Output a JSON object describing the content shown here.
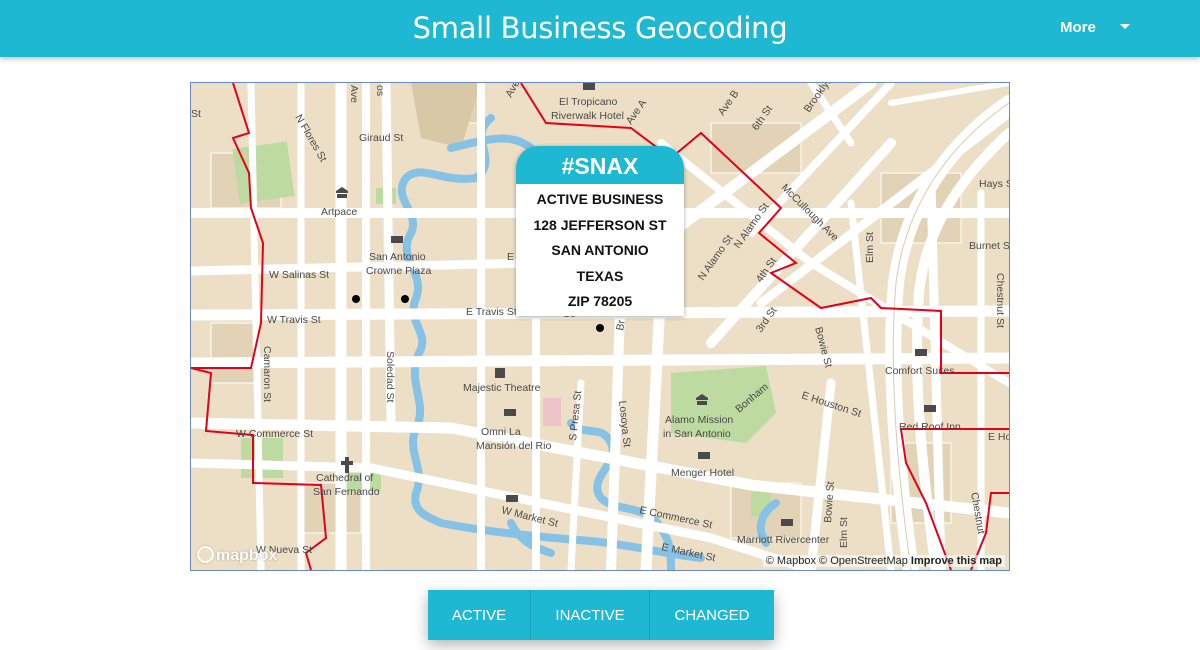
{
  "header": {
    "title": "Small Business Geocoding",
    "more_label": "More"
  },
  "popup": {
    "title": "#SNAX",
    "lines": [
      "ACTIVE BUSINESS",
      "128 JEFFERSON ST",
      "SAN ANTONIO",
      "TEXAS",
      "ZIP 78205"
    ]
  },
  "map": {
    "attribution": "© Mapbox © OpenStreetMap",
    "improve_label": "Improve this map",
    "logo": "mapbox",
    "labels": {
      "el_tropicano": "El Tropicano",
      "riverwalk_hotel": "Riverwalk Hotel",
      "artpace": "Artpace",
      "san_antonio": "San Antonio",
      "crowne_plaza": "Crowne Plaza",
      "majestic_theatre": "Majestic Theatre",
      "omni_la": "Omni La",
      "mansion_del_rio": "Mansión del Rio",
      "cathedral_of": "Cathedral of",
      "san_fernando": "San Fernando",
      "alamo_mission": "Alamo Mission",
      "in_san_antonio": "in San Antonio",
      "menger_hotel": "Menger Hotel",
      "marriott_rivercenter": "Marriott Rivercenter",
      "comfort_suites": "Comfort Suites",
      "red_roof_inn": "Red Roof Inn",
      "giraud_st": "Giraud St",
      "n_flores_st": "N Flores St",
      "w_salinas_st": "W Salinas St",
      "w_travis_st": "W Travis St",
      "e_travis_st": "E Travis St",
      "w_commerce_st": "W Commerce St",
      "w_market_st": "W Market St",
      "e_commerce_st": "E Commerce St",
      "e_market_st": "E Market St",
      "w_nueva_st": "W Nueva St",
      "soledad_st": "Soledad St",
      "camaron_st": "Camaron St",
      "losoya_st": "Losoya St",
      "s_presa_st": "S Presa St",
      "n_alamo_st_1": "N Alamo St",
      "n_alamo_st_2": "N Alamo St",
      "mccullough_ave": "McCullough Ave",
      "elm_st_1": "Elm St",
      "elm_st_2": "Elm St",
      "bowie_st_1": "Bowie St",
      "bowie_st_2": "Bowie St",
      "e_houston_st": "E Houston St",
      "bonham": "Bonham",
      "hays_st": "Hays St",
      "burnet_st": "Burnet St",
      "chestnut_st_1": "Chestnut St",
      "chestnut_st_2": "Chestnut",
      "brooklyn_ave": "Brooklyn Ave",
      "ave_a": "Ave A",
      "ave_b": "Ave B",
      "sixth_st": "6th St",
      "fourth_st": "4th St",
      "third_st": "3rd St",
      "ave_1": "Ave",
      "os": "os",
      "e_hou": "E Ho",
      "e_char": "E",
      "br": "Br",
      "se": "Se",
      "st": "St",
      "ave_c": "Ave"
    }
  },
  "buttons": [
    {
      "label": "Active"
    },
    {
      "label": "Inactive"
    },
    {
      "label": "Changed"
    }
  ],
  "colors": {
    "accent": "#1fb8d3",
    "boundary": "#e3001b",
    "river": "#86c1e6",
    "park": "#bddaa0",
    "land": "#ecdfc6"
  }
}
